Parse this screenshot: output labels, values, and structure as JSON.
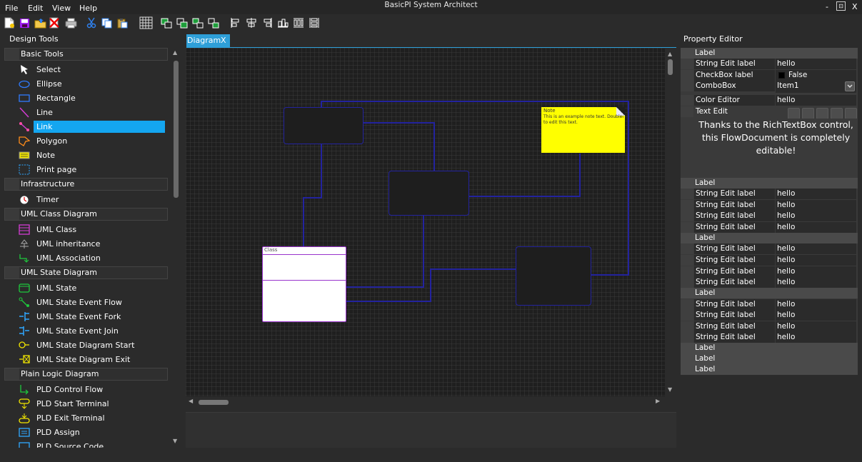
{
  "window": {
    "title": "BasicPI System Architect",
    "min": "-",
    "restore": "⊡",
    "close": "X"
  },
  "menu": [
    "File",
    "Edit",
    "View",
    "Help"
  ],
  "left_panel": {
    "title": "Design Tools",
    "categories": [
      {
        "label": "Basic Tools",
        "items": [
          "Select",
          "Ellipse",
          "Rectangle",
          "Line",
          "Link",
          "Polygon",
          "Note",
          "Print page"
        ]
      },
      {
        "label": "Infrastructure",
        "items": [
          "Timer"
        ]
      },
      {
        "label": "UML Class Diagram",
        "items": [
          "UML Class",
          "UML inheritance",
          "UML Association"
        ]
      },
      {
        "label": "UML State Diagram",
        "items": [
          "UML State",
          "UML State Event Flow",
          "UML State Event Fork",
          "UML State Event Join",
          "UML State Diagram Start",
          "UML State Diagram Exit"
        ]
      },
      {
        "label": "Plain Logic Diagram",
        "items": [
          "PLD Control Flow",
          "PLD Start Terminal",
          "PLD Exit Terminal",
          "PLD Assign",
          "PLD Source Code"
        ]
      }
    ],
    "selected_item": "Link"
  },
  "document_tab": {
    "label": "Diagram",
    "close": "X"
  },
  "diagram": {
    "note": {
      "title": "Note",
      "text_line1": "This is an example note text. Doubleclick",
      "text_line2": "to edit this text."
    },
    "uml_class": {
      "name": "Class"
    }
  },
  "right_panel": {
    "title": "Property Editor",
    "first_group": {
      "label": "Label",
      "string_edit": {
        "name": "String Edit label",
        "value": "hello"
      },
      "checkbox": {
        "name": "CheckBox label",
        "value": "False"
      },
      "combo": {
        "name": "ComboBox",
        "value": "Item1"
      },
      "color": {
        "name": "Color Editor",
        "value": "hello"
      },
      "text_edit": {
        "name": "Text Edit"
      },
      "rich_text": "Thanks to the RichTextBox control, this FlowDocument is completely editable!"
    },
    "groups": [
      {
        "label": "Label",
        "rows": [
          {
            "name": "String Edit label",
            "value": "hello"
          },
          {
            "name": "String Edit label",
            "value": "hello"
          },
          {
            "name": "String Edit label",
            "value": "hello"
          },
          {
            "name": "String Edit label",
            "value": "hello"
          }
        ]
      },
      {
        "label": "Label",
        "rows": [
          {
            "name": "String Edit label",
            "value": "hello"
          },
          {
            "name": "String Edit label",
            "value": "hello"
          },
          {
            "name": "String Edit label",
            "value": "hello"
          },
          {
            "name": "String Edit label",
            "value": "hello"
          }
        ]
      },
      {
        "label": "Label",
        "rows": [
          {
            "name": "String Edit label",
            "value": "hello"
          },
          {
            "name": "String Edit label",
            "value": "hello"
          },
          {
            "name": "String Edit label",
            "value": "hello"
          },
          {
            "name": "String Edit label",
            "value": "hello"
          }
        ]
      }
    ],
    "trailing_labels": [
      "Label",
      "Label",
      "Label"
    ]
  },
  "colors": {
    "accent": "#14a6f0",
    "tab": "#2e9fd8",
    "connector": "#23239e",
    "note": "#ffff00",
    "uml_border": "#9933cc"
  }
}
